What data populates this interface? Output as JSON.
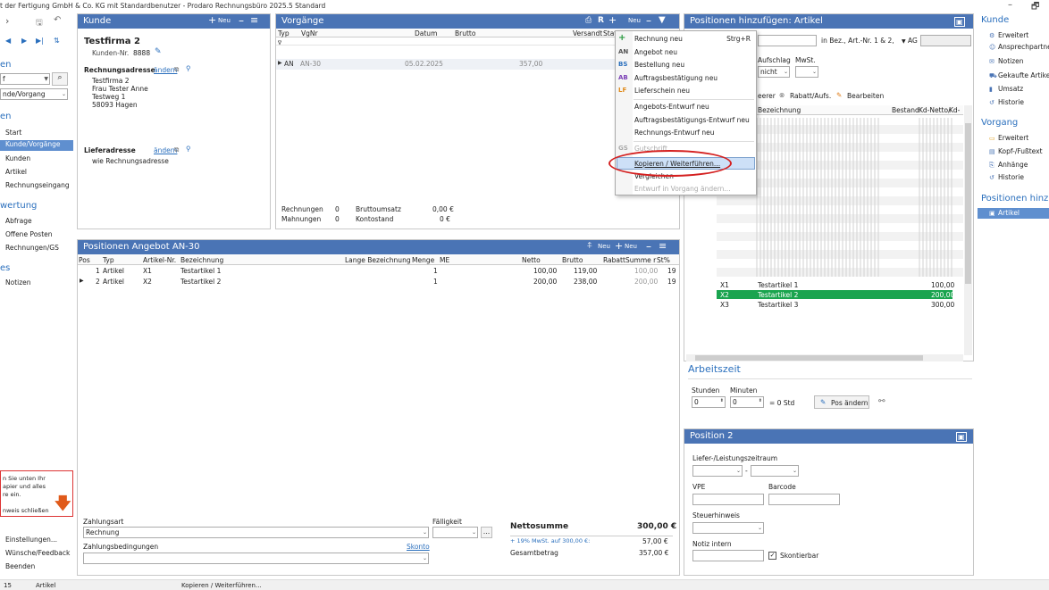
{
  "window": {
    "title": "t der Fertigung GmbH & Co. KG mit Standardbenutzer  -  Prodaro Rechnungsbüro 2025.5 Standard",
    "min": "–",
    "max": "🗗"
  },
  "toolbar_left": {
    "back": ">",
    "first": "◀",
    "next": "▶",
    "last": "▶|",
    "gt": "&."
  },
  "leftbar": {
    "section1": "en",
    "search_value": "f",
    "filter_value": "nde/Vorgang",
    "section2": "en",
    "items": [
      "Start",
      "Kunde/Vorgänge",
      "Kunden",
      "Artikel",
      "Rechnungseingang"
    ],
    "section3": "wertung",
    "items2": [
      "Abfrage",
      "Offene Posten",
      "Rechnungen/GS"
    ],
    "section4": "es",
    "items3": [
      "Notizen"
    ],
    "notice_lines": [
      "n Sie unten Ihr",
      "apier und alles",
      "re ein."
    ],
    "notice_close": "nweis schließen",
    "bottom_items": [
      "Einstellungen...",
      "Wünsche/Feedback",
      "Beenden"
    ]
  },
  "kunde": {
    "header": "Kunde",
    "new_label": "Neu",
    "name": "Testfirma 2",
    "kundennr_label": "Kunden-Nr.",
    "kundennr": "8888",
    "rechnungsadresse_label": "Rechnungsadresse",
    "aendern": "ändern",
    "address": [
      "Testfirma 2",
      "Frau Tester Anne",
      "Testweg 1",
      "58093 Hagen"
    ],
    "lieferadresse_label": "Lieferadresse",
    "lieferadresse_value": "wie Rechnungsadresse"
  },
  "vorgaenge": {
    "header": "Vorgänge",
    "columns": [
      "Typ",
      "VgNr",
      "Datum",
      "Brutto",
      "Versandt",
      "Stat"
    ],
    "row": {
      "typ": "AN",
      "vgnr": "AN-30",
      "datum": "05.02.2025",
      "brutto": "357,00"
    },
    "summary": [
      {
        "label": "Rechnungen",
        "count": "0",
        "label2": "Bruttoumsatz",
        "value": "0,00 €"
      },
      {
        "label": "Mahnungen",
        "count": "0",
        "label2": "Kontostand",
        "value": "0 €"
      }
    ]
  },
  "context_menu": {
    "items": [
      {
        "prefix": "+",
        "label": "Rechnung neu",
        "shortcut": "Strg+R",
        "state": "normal"
      },
      {
        "prefix": "AN",
        "label": "Angebot neu",
        "shortcut": "",
        "state": "normal"
      },
      {
        "prefix": "BS",
        "label": "Bestellung neu",
        "shortcut": "",
        "state": "normal"
      },
      {
        "prefix": "AB",
        "label": "Auftragsbestätigung neu",
        "shortcut": "",
        "state": "normal"
      },
      {
        "prefix": "LF",
        "label": "Lieferschein neu",
        "shortcut": "",
        "state": "normal"
      },
      {
        "prefix": "",
        "label": "Angebots-Entwurf neu",
        "shortcut": "",
        "state": "normal"
      },
      {
        "prefix": "",
        "label": "Auftragsbestätigungs-Entwurf neu",
        "shortcut": "",
        "state": "normal"
      },
      {
        "prefix": "",
        "label": "Rechnungs-Entwurf neu",
        "shortcut": "",
        "state": "normal"
      },
      {
        "prefix": "GS",
        "label": "Gutschrift...",
        "shortcut": "",
        "state": "disabled"
      },
      {
        "prefix": "",
        "label": "Kopieren / Weiterführen...",
        "shortcut": "",
        "state": "highlight"
      },
      {
        "prefix": "",
        "label": "Vergleichen",
        "shortcut": "",
        "state": "normal"
      },
      {
        "prefix": "",
        "label": "Entwurf in Vorgang ändern...",
        "shortcut": "",
        "state": "disabled"
      }
    ]
  },
  "positionen_angebot": {
    "header": "Positionen Angebot AN-30",
    "new1": "Neu",
    "new2": "Neu",
    "columns": [
      "Pos",
      "Typ",
      "Artikel-Nr.",
      "Bezeichnung",
      "Lange Bezeichnung",
      "Menge",
      "ME",
      "Netto",
      "Brutto",
      "Rabatt",
      "Summe r",
      "St%"
    ],
    "rows": [
      {
        "pos": "1",
        "typ": "Artikel",
        "nr": "X1",
        "bez": "Testartikel 1",
        "menge": "1",
        "netto": "100,00",
        "brutto": "119,00",
        "summe": "100,00",
        "st": "19"
      },
      {
        "pos": "2",
        "typ": "Artikel",
        "nr": "X2",
        "bez": "Testartikel 2",
        "menge": "1",
        "netto": "200,00",
        "brutto": "238,00",
        "summe": "200,00",
        "st": "19"
      }
    ],
    "zahlungsart_label": "Zahlungsart",
    "zahlungsart_value": "Rechnung",
    "faelligkeit_label": "Fälligkeit",
    "zahlungsbed_label": "Zahlungsbedingungen",
    "skonto_label": "Skonto",
    "nettosumme_label": "Nettosumme",
    "nettosumme_value": "300,00  €",
    "mwst_label": "+ 19% MwSt. auf 300,00 €:",
    "mwst_value": "57,00  €",
    "gesamt_label": "Gesamtbetrag",
    "gesamt_value": "357,00  €"
  },
  "positionen_hinzufuegen": {
    "header": "Positionen hinzufügen: Artikel",
    "search_in": "in  Bez., Art.-Nr. 1 & 2,",
    "ag": "AG",
    "aufschlag_label": "Aufschlag",
    "mwst_label": "MwSt.",
    "aufschlag_value": "nicht",
    "leerer": "eerer",
    "rabatt": "Rabatt/Aufs.",
    "bearbeiten": "Bearbeiten",
    "columns": [
      "Bezeichnung",
      "Bestand",
      "Kd-Netto/",
      "Kd-"
    ],
    "rows": [
      {
        "nr": "X1",
        "bez": "Testartikel 1",
        "preis": "100,00"
      },
      {
        "nr": "X2",
        "bez": "Testartikel 2",
        "preis": "200,00"
      },
      {
        "nr": "X3",
        "bez": "Testartikel 3",
        "preis": "300,00"
      }
    ]
  },
  "arbeitszeit": {
    "header": "Arbeitszeit",
    "stunden_label": "Stunden",
    "minuten_label": "Minuten",
    "stunden_value": "0",
    "minuten_value": "0",
    "result": "= 0 Std",
    "pos_aendern": "Pos ändern"
  },
  "position2": {
    "header": "Position 2",
    "zeitraum_label": "Liefer-/Leistungszeitraum",
    "vpe_label": "VPE",
    "barcode_label": "Barcode",
    "steuerhinweis_label": "Steuerhinweis",
    "notiz_label": "Notiz intern",
    "skontierbar_label": "Skontierbar"
  },
  "rightbar": {
    "kunde_section": "Kunde",
    "kunde_items": [
      "Erweitert",
      "Ansprechpartner",
      "Notizen",
      "Gekaufte Artikel",
      "Umsatz",
      "Historie"
    ],
    "vorgang_section": "Vorgang",
    "vorgang_items": [
      "Erweitert",
      "Kopf-/Fußtext",
      "Anhänge",
      "Historie"
    ],
    "pos_section": "Positionen hinzufügen",
    "pos_items": [
      "Artikel"
    ]
  },
  "statusbar": {
    "left": "15",
    "mid": "Artikel",
    "right": "Kopieren / Weiterführen..."
  },
  "colors": {
    "panel_header": "#4a74b5",
    "accent_blue": "#2a6fbd",
    "selected_green": "#1aa44f",
    "highlight_circle": "#d42020"
  }
}
